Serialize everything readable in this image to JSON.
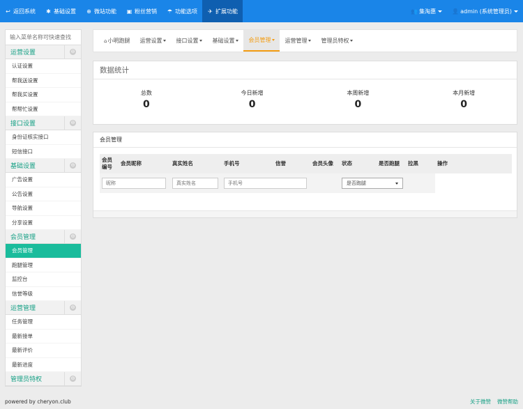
{
  "topnav": {
    "items": [
      {
        "icon": "↩",
        "label": "返回系统"
      },
      {
        "icon": "✱",
        "label": "基础设置"
      },
      {
        "icon": "⊕",
        "label": "微站功能"
      },
      {
        "icon": "▣",
        "label": "粉丝营销"
      },
      {
        "icon": "☂",
        "label": "功能选项"
      },
      {
        "icon": "✈",
        "label": "扩展功能"
      }
    ],
    "user_group": "集淘惠",
    "admin": "admin (系统管理员)"
  },
  "sidebar": {
    "search_placeholder": "输入菜单名称可快速查找",
    "toggle_symbol": "⊖",
    "groups": [
      {
        "title": "运营设置",
        "items": [
          "认证设置",
          "帮我送设置",
          "帮我买设置",
          "帮帮忙设置"
        ]
      },
      {
        "title": "接口设置",
        "items": [
          "身份证核实接口",
          "短信接口"
        ]
      },
      {
        "title": "基础设置",
        "items": [
          "广告设置",
          "公告设置",
          "导航设置",
          "分享设置"
        ]
      },
      {
        "title": "会员管理",
        "items": [
          "会员管理",
          "跑腿管理",
          "监控台",
          "信誉等级"
        ]
      },
      {
        "title": "运营管理",
        "items": [
          "任务管理",
          "最新接单",
          "最新评价",
          "最新进度"
        ]
      },
      {
        "title": "管理员特权",
        "items": []
      }
    ]
  },
  "tabs": [
    "小明跑腿",
    "运营设置",
    "接口设置",
    "基础设置",
    "会员管理",
    "运营管理",
    "管理员特权"
  ],
  "stats": {
    "title": "数据统计",
    "cells": [
      {
        "label": "总数",
        "value": "0"
      },
      {
        "label": "今日新增",
        "value": "0"
      },
      {
        "label": "本周新增",
        "value": "0"
      },
      {
        "label": "本月新增",
        "value": "0"
      }
    ]
  },
  "members": {
    "title": "会员管理",
    "headers": {
      "id": "会员编号",
      "nickname": "会员昵称",
      "realname": "真实姓名",
      "phone": "手机号",
      "credit": "信誉",
      "avatar": "会员头像",
      "status": "状态",
      "runner": "是否跑腿",
      "blacklist": "拉黑",
      "actions": "操作"
    },
    "filters": {
      "nickname": "昵称",
      "realname": "真实姓名",
      "phone": "手机号",
      "runner_select": "是否跑腿"
    }
  },
  "footer": {
    "powered": "powered by cheryon.club",
    "links": [
      "关于微赞",
      "微赞帮助"
    ]
  },
  "colors": {
    "topbar": "#1a85e8",
    "accent": "#16a085",
    "active_item": "#1abc9c",
    "active_tab": "#f39c12"
  }
}
